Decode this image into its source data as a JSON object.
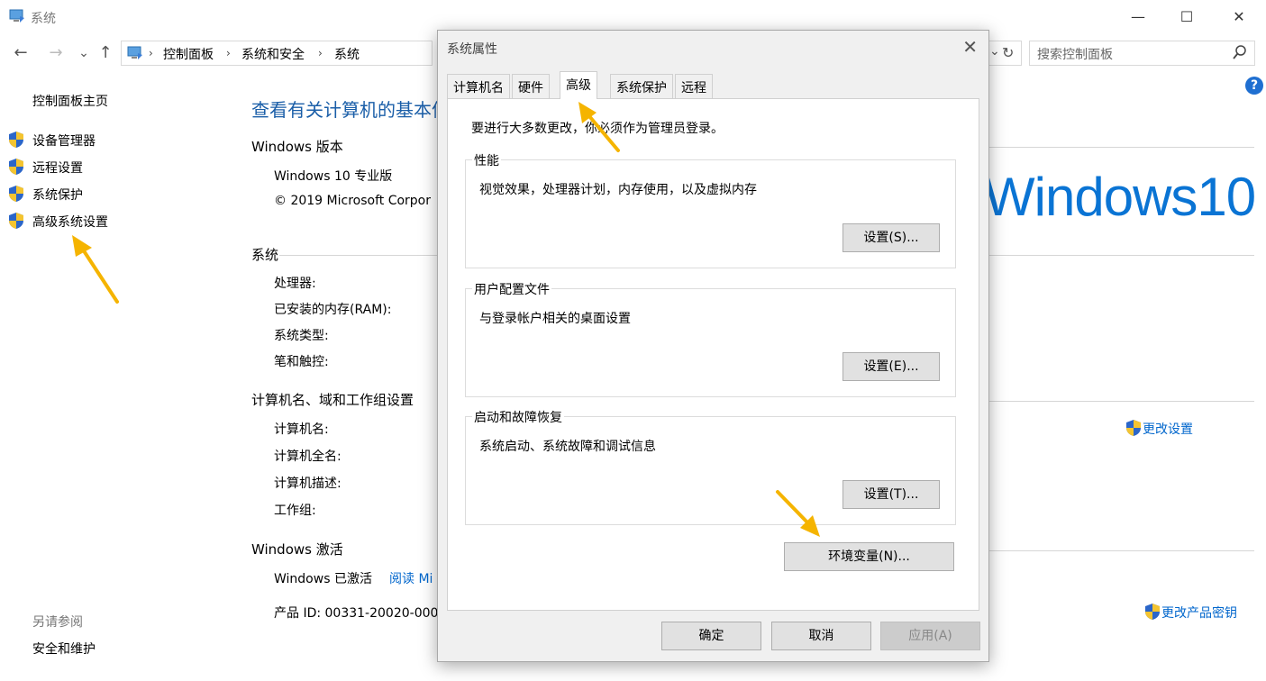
{
  "window": {
    "title": "系统",
    "minimize": "—",
    "maximize": "☐",
    "close": "✕"
  },
  "nav": {
    "back": "←",
    "forward": "→",
    "recent": "⌄",
    "up": "↑",
    "breadcrumb": [
      "控制面板",
      "系统和安全",
      "系统"
    ],
    "breadcrumb_sep": "›",
    "dropdown": "⌄",
    "refresh": "↻",
    "search_placeholder": "搜索控制面板"
  },
  "sidebar": {
    "home": "控制面板主页",
    "items": [
      {
        "label": "设备管理器"
      },
      {
        "label": "远程设置"
      },
      {
        "label": "系统保护"
      },
      {
        "label": "高级系统设置"
      }
    ],
    "see_also_title": "另请参阅",
    "see_also_items": [
      "安全和维护"
    ]
  },
  "main": {
    "heading": "查看有关计算机的基本信",
    "windows_edition": {
      "title": "Windows 版本",
      "edition": "Windows 10 专业版",
      "copyright": "© 2019 Microsoft Corpor"
    },
    "logo_text": "Windows10",
    "system": {
      "title": "系统",
      "rows": [
        "处理器:",
        "已安装的内存(RAM):",
        "系统类型:",
        "笔和触控:"
      ]
    },
    "computer_name": {
      "title": "计算机名、域和工作组设置",
      "rows": [
        "计算机名:",
        "计算机全名:",
        "计算机描述:",
        "工作组:"
      ],
      "change_settings": "更改设置"
    },
    "activation": {
      "title": "Windows 激活",
      "status": "Windows 已激活",
      "read_link": "阅读 Mi",
      "product_id": "产品 ID: 00331-20020-000",
      "change_key": "更改产品密钥"
    },
    "help": "?"
  },
  "dialog": {
    "title": "系统属性",
    "close": "✕",
    "tabs": [
      "计算机名",
      "硬件",
      "高级",
      "系统保护",
      "远程"
    ],
    "active_tab": "高级",
    "intro": "要进行大多数更改，你必须作为管理员登录。",
    "groups": [
      {
        "label": "性能",
        "desc": "视觉效果，处理器计划，内存使用，以及虚拟内存",
        "button": "设置(S)..."
      },
      {
        "label": "用户配置文件",
        "desc": "与登录帐户相关的桌面设置",
        "button": "设置(E)..."
      },
      {
        "label": "启动和故障恢复",
        "desc": "系统启动、系统故障和调试信息",
        "button": "设置(T)..."
      }
    ],
    "env_button": "环境变量(N)...",
    "ok": "确定",
    "cancel": "取消",
    "apply": "应用(A)"
  },
  "colors": {
    "accent_blue": "#0066cc",
    "heading_blue": "#1a5ea8",
    "logo_blue": "#0a74d4",
    "arrow": "#f5b400"
  }
}
